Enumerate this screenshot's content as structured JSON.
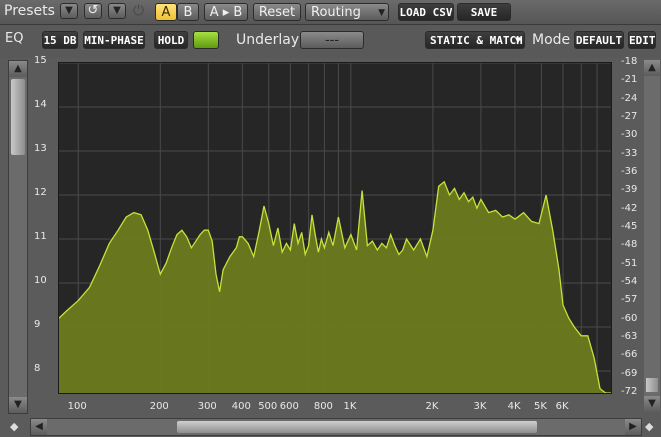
{
  "toolbar": {
    "presets_label": "Presets",
    "undo_icon": "undo-icon",
    "dropdown_icon": "chevron-down-icon",
    "power_icon": "power-icon",
    "a_label": "A",
    "b_label": "B",
    "ab_label": "A ▸ B",
    "reset_label": "Reset",
    "routing_label": "Routing",
    "load_csv_label": "LOAD CSV",
    "save_csv_label": "SAVE CSV"
  },
  "secondbar": {
    "eq_label": "EQ",
    "range_label": "15 DB",
    "phase_label": "MIN-PHASE",
    "hold_label": "HOLD",
    "underlay_label": "Underlay",
    "underlay_value": "---",
    "static_match_label": "STATIC & MATCH",
    "mode_label": "Mode",
    "default_label": "DEFAULT",
    "edit_label": "EDIT"
  },
  "colors": {
    "accent_yellow": "#f4c94a",
    "hold_green": "#7dbb1c",
    "spectrum_fill": "#6b7a1e",
    "spectrum_line": "#c7e23a",
    "plot_bg": "#262626"
  },
  "chart_data": {
    "type": "area",
    "x_scale": "log",
    "xlim": [
      85,
      9000
    ],
    "ylim": [
      7.5,
      15
    ],
    "x_ticks": [
      "100",
      "200",
      "300",
      "400",
      "500",
      "600",
      "800",
      "1K",
      "2K",
      "3K",
      "4K",
      "5K",
      "6K"
    ],
    "y_ticks_left": [
      "15",
      "14",
      "13",
      "12",
      "11",
      "10",
      "9",
      "8"
    ],
    "y_ticks_right": [
      "-18",
      "-21",
      "-24",
      "-27",
      "-30",
      "-33",
      "-36",
      "-39",
      "-42",
      "-45",
      "-48",
      "-51",
      "-54",
      "-57",
      "-60",
      "-63",
      "-66",
      "-69",
      "-72"
    ],
    "series": [
      {
        "x": [
          85,
          90,
          100,
          110,
          120,
          130,
          140,
          150,
          160,
          170,
          180,
          190,
          200,
          210,
          220,
          230,
          240,
          250,
          260,
          270,
          280,
          290,
          300,
          310,
          320,
          330,
          340,
          360,
          380,
          390,
          400,
          420,
          440,
          460,
          480,
          500,
          520,
          540,
          560,
          580,
          600,
          620,
          640,
          660,
          680,
          700,
          720,
          740,
          760,
          780,
          800,
          830,
          860,
          900,
          950,
          1000,
          1050,
          1100,
          1150,
          1200,
          1250,
          1300,
          1350,
          1400,
          1450,
          1500,
          1550,
          1600,
          1700,
          1800,
          1900,
          2000,
          2100,
          2200,
          2300,
          2400,
          2500,
          2600,
          2700,
          2800,
          2900,
          3000,
          3200,
          3400,
          3600,
          3800,
          4000,
          4300,
          4600,
          4900,
          5200,
          5500,
          5800,
          6000,
          6300,
          6600,
          7000,
          7400,
          7800,
          8200,
          8600,
          9000
        ],
        "y": [
          9.2,
          9.35,
          9.6,
          9.9,
          10.4,
          10.9,
          11.2,
          11.5,
          11.6,
          11.55,
          11.2,
          10.7,
          10.2,
          10.45,
          10.8,
          11.1,
          11.2,
          11.05,
          10.8,
          10.95,
          11.1,
          11.2,
          11.2,
          10.95,
          10.2,
          9.8,
          10.3,
          10.6,
          10.8,
          11.05,
          11.05,
          10.9,
          10.6,
          11.15,
          11.75,
          11.35,
          10.85,
          11.25,
          10.7,
          10.9,
          10.75,
          11.35,
          10.9,
          11.15,
          10.65,
          10.85,
          11.55,
          11.1,
          10.7,
          11.0,
          10.8,
          11.15,
          10.85,
          11.5,
          10.8,
          11.1,
          10.75,
          12.1,
          10.85,
          10.95,
          10.75,
          10.9,
          10.8,
          11.1,
          10.85,
          10.65,
          10.75,
          11.0,
          10.75,
          11.0,
          10.6,
          11.2,
          12.2,
          12.3,
          12.0,
          12.15,
          11.9,
          12.05,
          11.85,
          11.95,
          11.7,
          11.9,
          11.6,
          11.65,
          11.5,
          11.55,
          11.45,
          11.6,
          11.4,
          11.35,
          12.0,
          11.2,
          10.3,
          9.5,
          9.2,
          9.0,
          8.8,
          8.8,
          8.3,
          7.6,
          7.5,
          7.5
        ]
      }
    ]
  }
}
